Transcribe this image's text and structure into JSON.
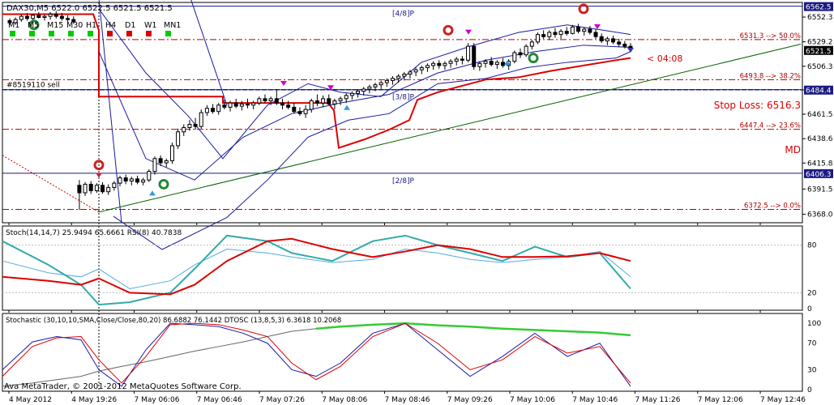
{
  "chart_data": {
    "type": "candlestick",
    "main": {
      "symbol_line": "DAX30,M5  6522.0 6522.5 6521.5 6521.5",
      "timeframes": [
        "M1",
        "M5",
        "M15",
        "M30",
        "H1",
        "H4",
        "D1",
        "W1",
        "MN1"
      ],
      "tf_colors": [
        "#00cc00",
        "#00cc00",
        "#00cc00",
        "#00cc00",
        "#00cc00",
        "#dd0000",
        "#dd0000",
        "#dd0000",
        "#00cc00"
      ],
      "ylim": [
        6360,
        6566
      ],
      "price_ticks": [
        {
          "y": 6552.3,
          "label": "6552.3"
        },
        {
          "y": 6529.2,
          "label": "6529.2"
        },
        {
          "y": 6506.3,
          "label": "6506.3"
        },
        {
          "y": 6484.2,
          "label": "6484.2"
        },
        {
          "y": 6461.5,
          "label": "6461.5"
        },
        {
          "y": 6438.6,
          "label": "6438.6"
        },
        {
          "y": 6415.8,
          "label": "6415.8"
        },
        {
          "y": 6391.5,
          "label": "6391.5"
        },
        {
          "y": 6368.0,
          "label": "6368.0"
        }
      ],
      "price_tags": [
        {
          "y": 6562.5,
          "label": "6562.5",
          "color": "#1a1a80"
        },
        {
          "y": 6521.5,
          "label": "6521.5",
          "color": "#000000"
        },
        {
          "y": 6484.4,
          "label": "6484.4",
          "color": "#1a1a80"
        },
        {
          "y": 6406.3,
          "label": "6406.3",
          "color": "#1a1a80"
        }
      ],
      "murrey_lines": [
        {
          "y": 6562.5,
          "label": "[4/8]P"
        },
        {
          "y": 6484.4,
          "label": "[3/8]P"
        },
        {
          "y": 6406.3,
          "label": "[2/8]P"
        }
      ],
      "fib_levels": [
        {
          "y": 6531.3,
          "label": "6531.3 --> 50.0%"
        },
        {
          "y": 6493.8,
          "label": "6493.8 --> 38.2%"
        },
        {
          "y": 6447.4,
          "label": "6447.4 --> 23.6%"
        },
        {
          "y": 6372.5,
          "label": "6372.5 --> 0.0%"
        }
      ],
      "order_label": "#8519110 sell",
      "stop_loss": "Stop Loss: 6516.3",
      "md_label": "MD",
      "timer": "< 04:08",
      "candles": [
        [
          6549,
          6551,
          6545,
          6547
        ],
        [
          6547,
          6552,
          6545,
          6550
        ],
        [
          6550,
          6555,
          6548,
          6553
        ],
        [
          6553,
          6556,
          6549,
          6551
        ],
        [
          6551,
          6555,
          6548,
          6554
        ],
        [
          6554,
          6557,
          6551,
          6552
        ],
        [
          6552,
          6555,
          6549,
          6553
        ],
        [
          6553,
          6557,
          6550,
          6555
        ],
        [
          6555,
          6558,
          6551,
          6553
        ],
        [
          6553,
          6556,
          6549,
          6551
        ],
        [
          6551,
          6554,
          6547,
          6550
        ],
        [
          6550,
          6553,
          6546,
          6548
        ],
        [
          6395,
          6400,
          6372,
          6388
        ],
        [
          6388,
          6398,
          6385,
          6396
        ],
        [
          6396,
          6399,
          6387,
          6390
        ],
        [
          6390,
          6397,
          6388,
          6395
        ],
        [
          6395,
          6398,
          6387,
          6389
        ],
        [
          6389,
          6396,
          6386,
          6393
        ],
        [
          6393,
          6399,
          6390,
          6397
        ],
        [
          6397,
          6404,
          6394,
          6402
        ],
        [
          6402,
          6405,
          6396,
          6399
        ],
        [
          6399,
          6403,
          6395,
          6401
        ],
        [
          6401,
          6404,
          6396,
          6398
        ],
        [
          6398,
          6402,
          6395,
          6400
        ],
        [
          6400,
          6410,
          6398,
          6408
        ],
        [
          6408,
          6422,
          6405,
          6420
        ],
        [
          6420,
          6423,
          6413,
          6416
        ],
        [
          6416,
          6420,
          6412,
          6418
        ],
        [
          6418,
          6435,
          6415,
          6432
        ],
        [
          6432,
          6448,
          6429,
          6445
        ],
        [
          6445,
          6452,
          6441,
          6449
        ],
        [
          6449,
          6456,
          6446,
          6452
        ],
        [
          6452,
          6458,
          6447,
          6450
        ],
        [
          6450,
          6466,
          6448,
          6463
        ],
        [
          6463,
          6470,
          6460,
          6467
        ],
        [
          6467,
          6471,
          6462,
          6464
        ],
        [
          6464,
          6472,
          6461,
          6470
        ],
        [
          6470,
          6475,
          6466,
          6468
        ],
        [
          6468,
          6474,
          6464,
          6472
        ],
        [
          6472,
          6476,
          6467,
          6469
        ],
        [
          6469,
          6474,
          6465,
          6471
        ],
        [
          6471,
          6476,
          6467,
          6470
        ],
        [
          6470,
          6474,
          6466,
          6472
        ],
        [
          6472,
          6478,
          6470,
          6476
        ],
        [
          6476,
          6480,
          6472,
          6474
        ],
        [
          6474,
          6478,
          6470,
          6476
        ],
        [
          6476,
          6484,
          6470,
          6472
        ],
        [
          6472,
          6476,
          6466,
          6470
        ],
        [
          6470,
          6474,
          6466,
          6468
        ],
        [
          6468,
          6472,
          6462,
          6464
        ],
        [
          6464,
          6468,
          6460,
          6462
        ],
        [
          6462,
          6470,
          6458,
          6466
        ],
        [
          6466,
          6476,
          6463,
          6474
        ],
        [
          6474,
          6480,
          6469,
          6472
        ],
        [
          6472,
          6479,
          6468,
          6476
        ],
        [
          6476,
          6480,
          6470,
          6471
        ],
        [
          6471,
          6476,
          6466,
          6474
        ],
        [
          6474,
          6478,
          6470,
          6476
        ],
        [
          6476,
          6481,
          6472,
          6479
        ],
        [
          6479,
          6483,
          6475,
          6481
        ],
        [
          6481,
          6485,
          6477,
          6483
        ],
        [
          6483,
          6487,
          6479,
          6485
        ],
        [
          6485,
          6489,
          6481,
          6487
        ],
        [
          6487,
          6491,
          6483,
          6489
        ],
        [
          6489,
          6493,
          6485,
          6491
        ],
        [
          6491,
          6495,
          6487,
          6493
        ],
        [
          6493,
          6497,
          6489,
          6495
        ],
        [
          6495,
          6499,
          6491,
          6497
        ],
        [
          6497,
          6501,
          6493,
          6499
        ],
        [
          6499,
          6503,
          6495,
          6501
        ],
        [
          6501,
          6505,
          6497,
          6503
        ],
        [
          6503,
          6507,
          6499,
          6505
        ],
        [
          6505,
          6509,
          6501,
          6507
        ],
        [
          6507,
          6511,
          6503,
          6509
        ],
        [
          6509,
          6512,
          6504,
          6507
        ],
        [
          6507,
          6511,
          6503,
          6509
        ],
        [
          6509,
          6513,
          6505,
          6511
        ],
        [
          6511,
          6515,
          6507,
          6513
        ],
        [
          6513,
          6516,
          6508,
          6512
        ],
        [
          6512,
          6528,
          6510,
          6525
        ],
        [
          6525,
          6528,
          6503,
          6506
        ],
        [
          6506,
          6511,
          6502,
          6509
        ],
        [
          6509,
          6513,
          6505,
          6511
        ],
        [
          6511,
          6515,
          6506,
          6508
        ],
        [
          6508,
          6512,
          6504,
          6510
        ],
        [
          6510,
          6514,
          6505,
          6507
        ],
        [
          6507,
          6513,
          6503,
          6511
        ],
        [
          6511,
          6521,
          6509,
          6519
        ],
        [
          6519,
          6523,
          6514,
          6517
        ],
        [
          6517,
          6527,
          6515,
          6525
        ],
        [
          6525,
          6531,
          6522,
          6529
        ],
        [
          6529,
          6538,
          6527,
          6536
        ],
        [
          6536,
          6540,
          6532,
          6534
        ],
        [
          6534,
          6540,
          6531,
          6538
        ],
        [
          6538,
          6542,
          6533,
          6536
        ],
        [
          6536,
          6541,
          6532,
          6539
        ],
        [
          6539,
          6543,
          6535,
          6537
        ],
        [
          6537,
          6545,
          6536,
          6543
        ],
        [
          6543,
          6546,
          6537,
          6539
        ],
        [
          6539,
          6543,
          6535,
          6541
        ],
        [
          6541,
          6544,
          6536,
          6538
        ],
        [
          6538,
          6541,
          6532,
          6534
        ],
        [
          6534,
          6537,
          6528,
          6530
        ],
        [
          6530,
          6534,
          6526,
          6532
        ],
        [
          6532,
          6535,
          6527,
          6529
        ],
        [
          6529,
          6532,
          6524,
          6527
        ],
        [
          6527,
          6530,
          6523,
          6525
        ],
        [
          6525,
          6528,
          6521,
          6522
        ]
      ]
    },
    "sub1": {
      "title": "Stoch(14,14,7) 25.9494 65.6661  RSI(8) 40.7838",
      "ylim": [
        0,
        100
      ],
      "ticks": [
        {
          "y": 80,
          "label": "80"
        },
        {
          "y": 20,
          "label": "20"
        },
        {
          "y": 0,
          "label": "0"
        }
      ]
    },
    "sub2": {
      "title": "Stochastic (30,10,10,SMA,Close/Close,80,20) 86.6882 76.1442  DTOSC (13,8,5,3) 6.3618 10.2068",
      "ylim": [
        0,
        110
      ],
      "ticks": [
        {
          "y": 100,
          "label": "100"
        },
        {
          "y": 70,
          "label": "70"
        },
        {
          "y": 30,
          "label": "30"
        },
        {
          "y": 0,
          "label": "0"
        }
      ]
    },
    "x_ticks": [
      "4 May 2012",
      "4 May 19:26",
      "7 May 06:06",
      "7 May 06:46",
      "7 May 07:26",
      "7 May 08:06",
      "7 May 08:46",
      "7 May 09:26",
      "7 May 10:06",
      "7 May 10:46",
      "7 May 11:26",
      "7 May 12:06",
      "7 May 12:46"
    ],
    "watermark": "Ava MetaTrader, © 2001-2012 MetaQuotes Software Corp."
  }
}
